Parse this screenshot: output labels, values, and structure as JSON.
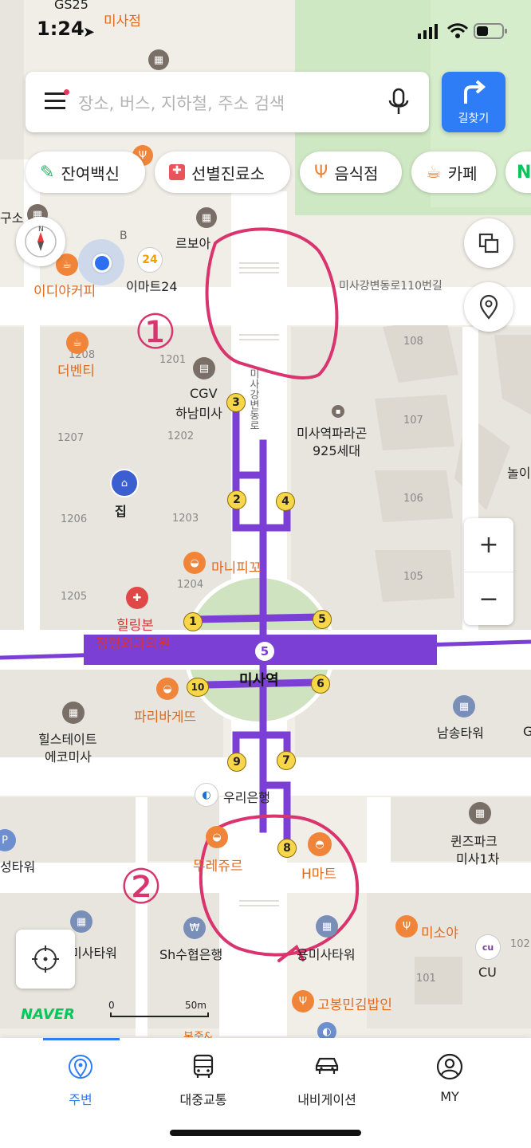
{
  "status": {
    "time": "1:24"
  },
  "search": {
    "placeholder": "장소, 버스, 지하철, 주소 검색"
  },
  "directions": {
    "label": "길찾기"
  },
  "chips": [
    {
      "label": "잔여백신"
    },
    {
      "label": "선별진료소"
    },
    {
      "label": "음식점"
    },
    {
      "label": "카페"
    }
  ],
  "map": {
    "labels": {
      "gs25": "GS25",
      "misa_branch_top": "미사점",
      "ediya": "이디야커피",
      "emart24": "이마트24",
      "emart24_badge": "24",
      "b_label": "B",
      "rebo": "르보아",
      "road_name": "미사강변동로110번길",
      "road_vertical": "미사강변동로",
      "the_venti": "더벤티",
      "cgv": "CGV",
      "cgv2": "하남미사",
      "paragon1": "미사역파라곤",
      "paragon2": "925세대",
      "home": "집",
      "manipiggu": "마니피꼬",
      "healing1": "힐링본",
      "healing2": "정형외과의원",
      "station": "미사역",
      "line_number": "5",
      "paris": "파리바게뜨",
      "hillstate1": "힐스테이트",
      "hillstate2": "에코미사",
      "namsong": "남송타워",
      "woori": "우리은행",
      "queens1": "퀸즈파크",
      "queens2": "미사1차",
      "seongtower": "성타워",
      "tous": "뚜레쥬르",
      "hmart": "H마트",
      "misa_tower": "미사타워",
      "sh": "Sh수협은행",
      "yongmisa": "용미사타워",
      "misoya": "미소야",
      "cu": "CU",
      "gobong": "고봉민김밥인",
      "bongjuk": "본죽&",
      "gu_so": "구소",
      "noi": "놀이",
      "g_edge": "G",
      "annotation1": "①",
      "annotation2": "②"
    },
    "building_numbers": [
      "1208",
      "1201",
      "1207",
      "1202",
      "1206",
      "1203",
      "1205",
      "1204",
      "108",
      "107",
      "106",
      "105",
      "101",
      "102"
    ],
    "exits": [
      "1",
      "2",
      "3",
      "4",
      "5",
      "6",
      "7",
      "8",
      "9",
      "10"
    ],
    "scale": {
      "zero": "0",
      "distance": "50m"
    },
    "naver": "NAVER"
  },
  "tabs": [
    {
      "label": "주변"
    },
    {
      "label": "대중교통"
    },
    {
      "label": "내비게이션"
    },
    {
      "label": "MY"
    }
  ],
  "colors": {
    "accent": "#2e7cf6",
    "subway_line": "#7b3fd6",
    "annotation": "#d9346d",
    "poi_orange": "#e06b1f",
    "naver_green": "#03c75a"
  }
}
